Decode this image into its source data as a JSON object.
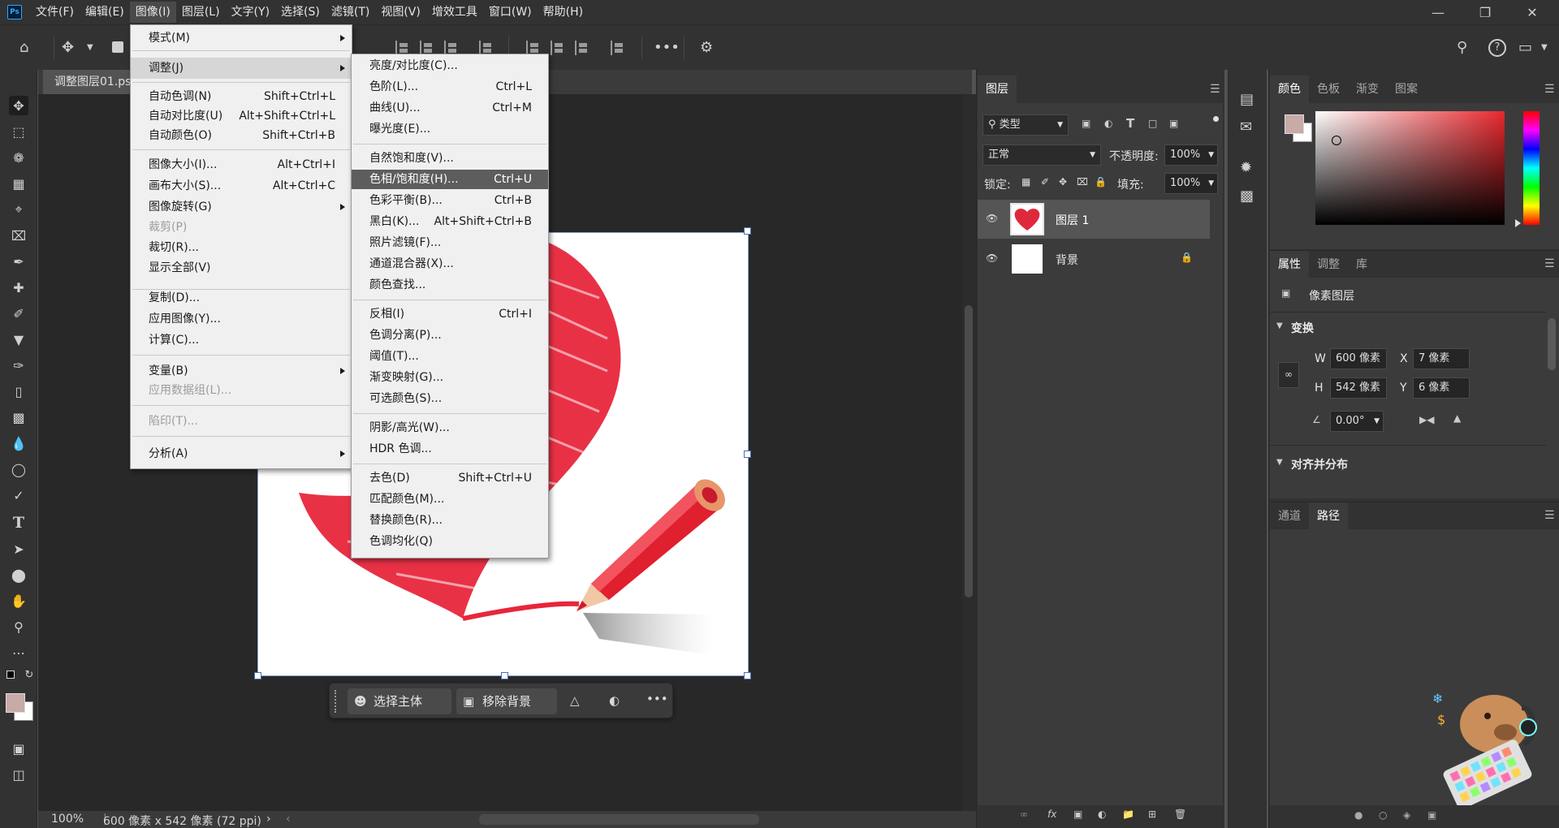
{
  "app": {
    "logo": "Ps"
  },
  "menubar": [
    "文件(F)",
    "编辑(E)",
    "图像(I)",
    "图层(L)",
    "文字(Y)",
    "选择(S)",
    "滤镜(T)",
    "视图(V)",
    "增效工具",
    "窗口(W)",
    "帮助(H)"
  ],
  "document": {
    "tab_title": "调整图层01.psd",
    "zoom": "100%",
    "doc_info": "600 像素 x 542 像素 (72 ppi)"
  },
  "task_bar": {
    "select_subject": "选择主体",
    "remove_bg": "移除背景"
  },
  "image_menu": {
    "items": [
      {
        "label": "模式(M)",
        "shortcut": "",
        "submenu": true
      },
      {
        "label": "调整(J)",
        "shortcut": "",
        "submenu": true
      },
      {
        "label": "自动色调(N)",
        "shortcut": "Shift+Ctrl+L"
      },
      {
        "label": "自动对比度(U)",
        "shortcut": "Alt+Shift+Ctrl+L"
      },
      {
        "label": "自动颜色(O)",
        "shortcut": "Shift+Ctrl+B"
      },
      {
        "label": "图像大小(I)...",
        "shortcut": "Alt+Ctrl+I"
      },
      {
        "label": "画布大小(S)...",
        "shortcut": "Alt+Ctrl+C"
      },
      {
        "label": "图像旋转(G)",
        "shortcut": "",
        "submenu": true
      },
      {
        "label": "裁剪(P)",
        "shortcut": "",
        "disabled": true
      },
      {
        "label": "裁切(R)...",
        "shortcut": ""
      },
      {
        "label": "显示全部(V)",
        "shortcut": ""
      },
      {
        "label": "复制(D)...",
        "shortcut": ""
      },
      {
        "label": "应用图像(Y)...",
        "shortcut": ""
      },
      {
        "label": "计算(C)...",
        "shortcut": ""
      },
      {
        "label": "变量(B)",
        "shortcut": "",
        "submenu": true
      },
      {
        "label": "应用数据组(L)...",
        "shortcut": "",
        "disabled": true
      },
      {
        "label": "陷印(T)...",
        "shortcut": "",
        "disabled": true
      },
      {
        "label": "分析(A)",
        "shortcut": "",
        "submenu": true
      }
    ]
  },
  "adjust_menu": {
    "items": [
      {
        "label": "亮度/对比度(C)...",
        "shortcut": ""
      },
      {
        "label": "色阶(L)...",
        "shortcut": "Ctrl+L"
      },
      {
        "label": "曲线(U)...",
        "shortcut": "Ctrl+M"
      },
      {
        "label": "曝光度(E)...",
        "shortcut": ""
      },
      {
        "label": "自然饱和度(V)...",
        "shortcut": ""
      },
      {
        "label": "色相/饱和度(H)...",
        "shortcut": "Ctrl+U"
      },
      {
        "label": "色彩平衡(B)...",
        "shortcut": "Ctrl+B"
      },
      {
        "label": "黑白(K)...",
        "shortcut": "Alt+Shift+Ctrl+B"
      },
      {
        "label": "照片滤镜(F)...",
        "shortcut": ""
      },
      {
        "label": "通道混合器(X)...",
        "shortcut": ""
      },
      {
        "label": "颜色查找...",
        "shortcut": ""
      },
      {
        "label": "反相(I)",
        "shortcut": "Ctrl+I"
      },
      {
        "label": "色调分离(P)...",
        "shortcut": ""
      },
      {
        "label": "阈值(T)...",
        "shortcut": ""
      },
      {
        "label": "渐变映射(G)...",
        "shortcut": ""
      },
      {
        "label": "可选颜色(S)...",
        "shortcut": ""
      },
      {
        "label": "阴影/高光(W)...",
        "shortcut": ""
      },
      {
        "label": "HDR 色调...",
        "shortcut": ""
      },
      {
        "label": "去色(D)",
        "shortcut": "Shift+Ctrl+U"
      },
      {
        "label": "匹配颜色(M)...",
        "shortcut": ""
      },
      {
        "label": "替换颜色(R)...",
        "shortcut": ""
      },
      {
        "label": "色调均化(Q)",
        "shortcut": ""
      }
    ]
  },
  "layers_panel": {
    "tab": "图层",
    "filter_kind": "类型",
    "blend_mode": "正常",
    "opacity_label": "不透明度:",
    "opacity": "100%",
    "lock_label": "锁定:",
    "fill_label": "填充:",
    "fill": "100%",
    "layers": [
      {
        "name": "图层 1",
        "selected": true
      },
      {
        "name": "背景",
        "locked": true
      }
    ]
  },
  "color_panel": {
    "tabs": [
      "颜色",
      "色板",
      "渐变",
      "图案"
    ],
    "foreground": "#c8aaa6",
    "hue_color": "#e8282e"
  },
  "properties_panel": {
    "tabs": [
      "属性",
      "调整",
      "库"
    ],
    "kind": "像素图层",
    "transform_title": "变换",
    "w_label": "W",
    "w": "600 像素",
    "x_label": "X",
    "x": "7 像素",
    "h_label": "H",
    "h": "542 像素",
    "y_label": "Y",
    "y": "6 像素",
    "angle": "0.00°",
    "align_title": "对齐并分布"
  },
  "paths_panel": {
    "tabs": [
      "通道",
      "路径"
    ]
  }
}
